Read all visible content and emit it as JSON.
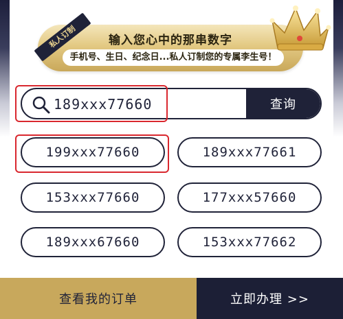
{
  "banner": {
    "tag": "私人订制",
    "title": "输入您心中的那串数字",
    "subtitle": "手机号、生日、纪念日...私人订制您的专属李生号！"
  },
  "search": {
    "value": "189xxx77660",
    "button_label": "查询"
  },
  "numbers": [
    "199xxx77660",
    "189xxx77661",
    "153xxx77660",
    "177xxx57660",
    "189xxx67660",
    "153xxx77662"
  ],
  "bottom_bar": {
    "orders_label": "查看我的订单",
    "apply_label": "立即办理 >>"
  },
  "colors": {
    "navy": "#1f2238",
    "gold": "#c8a85c",
    "highlight_red": "#d9272e"
  }
}
